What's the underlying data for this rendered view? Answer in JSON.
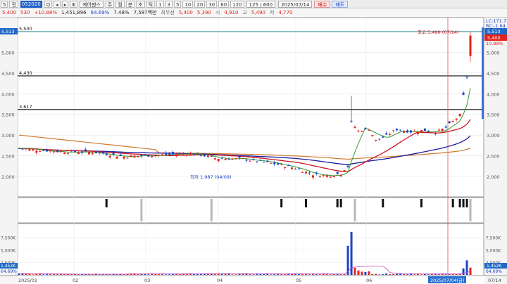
{
  "toolbar1": {
    "price_symbol": "5",
    "dropdown_label": "전",
    "code": "052020",
    "buttons": [
      "Q",
      "◂",
      "▸",
      "Ⅲ"
    ],
    "stock_name": "케어젠스",
    "chart_types": [
      "주",
      "월",
      "분",
      "초",
      "틱"
    ],
    "periods": [
      "1",
      "3",
      "5",
      "10",
      "20",
      "30",
      "60",
      "120"
    ],
    "count": "125 / 600",
    "date": "2025/07/14",
    "buy_label": "매수",
    "sell_label": "매도"
  },
  "quote": {
    "price": "5,400",
    "change": "530",
    "change_pct": "+10.88%",
    "volume": "1,451,896",
    "vol_ratio": "64.69%",
    "turnover": "7.48%",
    "amount": "7,587백만",
    "amount_note": "최우선",
    "ask": "5,400",
    "bid": "5,390",
    "open_label": "시",
    "open": "4,910",
    "high_label": "고",
    "high": "5,490",
    "low_label": "저",
    "low": "4,770"
  },
  "price_panel": {
    "hlines": [
      {
        "label": "5,500",
        "value": 5500,
        "color": "#1d7c7c"
      },
      {
        "label": "4,430",
        "value": 4430,
        "color": "#111"
      },
      {
        "label": "3,617",
        "value": 3617,
        "color": "#111"
      }
    ],
    "y_ticks": [
      "5,000",
      "4,500",
      "4,000",
      "3,500",
      "3,000",
      "2,500",
      "2,000"
    ],
    "high_annotation": "최고 5,490 (07/14)",
    "low_annotation": "최저 1,987 (04/09)",
    "right_labels": {
      "top": "LC:171.77",
      "mid": "RC:-1.64",
      "price_box": "5,513",
      "price": "5,400",
      "pct": "10.88%"
    },
    "left_box": "5,513"
  },
  "volume_panel": {
    "y_ticks": [
      "7,500K",
      "5,000K",
      "2,500K"
    ],
    "right_ticks": [
      "7,500K",
      "5,000K",
      "2,500K"
    ],
    "right_box": "1,452K",
    "right_pct": "64.69%",
    "left_box": "1,452K",
    "left_pct": "64.69%"
  },
  "x_axis": {
    "labels": [
      "2025/01",
      "02",
      "03",
      "04",
      "05",
      "06",
      "07/14"
    ],
    "cursor_label": "2025/07/04(금)"
  },
  "colors": {
    "up": "#e1231c",
    "down": "#1a44c8",
    "ma5": "#2f9a2f",
    "ma20": "#c8141e",
    "ma60": "#1a1aa0",
    "ma120": "#d0782c",
    "cursor": "#e05050"
  }
}
